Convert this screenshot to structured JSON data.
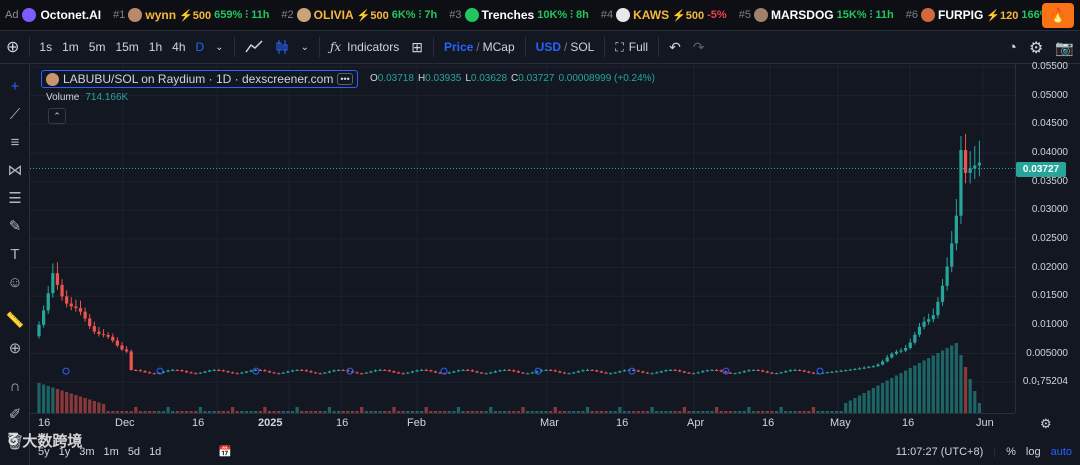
{
  "ticker": {
    "ad_label": "Ad",
    "sponsor": "Octonet.AI",
    "items": [
      {
        "rank": "#1",
        "name": "wynn",
        "boost": "⚡500",
        "pct": "659%",
        "trend": "up",
        "age": "11h",
        "name_color": "#f5b83d",
        "icon_color": "#b98a6a"
      },
      {
        "rank": "#2",
        "name": "OLIVIA",
        "boost": "⚡500",
        "pct": "6K%",
        "trend": "up",
        "age": "7h",
        "name_color": "#f5b83d",
        "icon_color": "#c9a27a"
      },
      {
        "rank": "#3",
        "name": "Trenches",
        "boost": "",
        "pct": "10K%",
        "trend": "up",
        "age": "8h",
        "name_color": "#ffffff",
        "icon_color": "#22c55e"
      },
      {
        "rank": "#4",
        "name": "KAWS",
        "boost": "⚡500",
        "pct": "-5%",
        "trend": "down",
        "age": "",
        "name_color": "#f5b83d",
        "icon_color": "#e8e8e8"
      },
      {
        "rank": "#5",
        "name": "MARSDOG",
        "boost": "",
        "pct": "15K%",
        "trend": "up",
        "age": "11h",
        "name_color": "#ffffff",
        "icon_color": "#a0826a"
      },
      {
        "rank": "#6",
        "name": "FURPIG",
        "boost": "⚡120",
        "pct": "166%",
        "trend": "up",
        "age": "",
        "name_color": "#ffffff",
        "icon_color": "#d06a3a"
      }
    ],
    "extra_rank": "5"
  },
  "toolbar": {
    "intervals": [
      "1s",
      "1m",
      "5m",
      "15m",
      "1h",
      "4h",
      "D"
    ],
    "active_interval": "D",
    "indicators_label": "Indicators",
    "price_label": "Price",
    "mcap_label": "MCap",
    "usd_label": "USD",
    "sol_label": "SOL",
    "full_label": "Full"
  },
  "legend": {
    "title": "LABUBU/SOL on Raydium · 1D · dexscreener.com",
    "o_label": "O",
    "o": "0.03718",
    "h_label": "H",
    "h": "0.03935",
    "l_label": "L",
    "l": "0.03628",
    "c_label": "C",
    "c": "0.03727",
    "change": "0.00008999 (+0.24%)",
    "volume_label": "Volume",
    "volume": "714.166K"
  },
  "price_scale": {
    "labels": [
      "0.05500",
      "0.05000",
      "0.04500",
      "0.04000",
      "0.03500",
      "0.03000",
      "0.02500",
      "0.02000",
      "0.01500",
      "0.01000",
      "0.005000",
      "0.0₁75204"
    ],
    "last_price": "0.03727"
  },
  "time_scale": {
    "labels": [
      {
        "text": "16",
        "bold": false
      },
      {
        "text": "Dec",
        "bold": false
      },
      {
        "text": "16",
        "bold": false
      },
      {
        "text": "2025",
        "bold": true
      },
      {
        "text": "16",
        "bold": false
      },
      {
        "text": "Feb",
        "bold": false
      },
      {
        "text": "Mar",
        "bold": false
      },
      {
        "text": "16",
        "bold": false
      },
      {
        "text": "Apr",
        "bold": false
      },
      {
        "text": "16",
        "bold": false
      },
      {
        "text": "May",
        "bold": false
      },
      {
        "text": "16",
        "bold": false
      },
      {
        "text": "Jun",
        "bold": false
      }
    ]
  },
  "bottom": {
    "ranges": [
      "5y",
      "1y",
      "3m",
      "1m",
      "5d",
      "1d"
    ],
    "time": "11:07:27 (UTC+8)",
    "pct": "%",
    "log": "log",
    "auto": "auto"
  },
  "watermark": "大数跨境",
  "colors": {
    "up": "#26a69a",
    "down": "#ef5350",
    "accent": "#2962ff",
    "background": "#131722"
  }
}
